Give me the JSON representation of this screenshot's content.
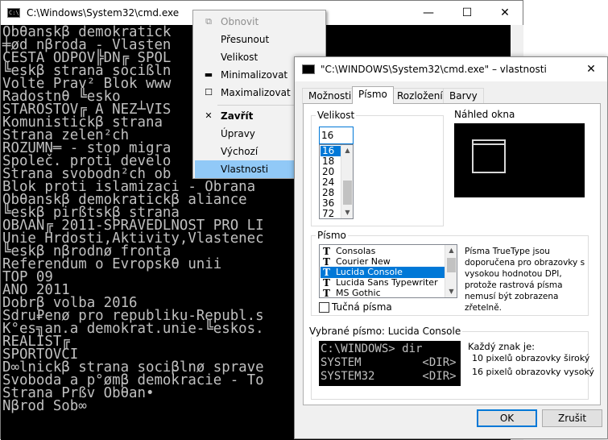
{
  "cmd": {
    "title": "C:\\Windows\\System32\\cmd.exe",
    "icon": "console-icon",
    "caption_buttons": {
      "minimize": "—",
      "maximize": "☐",
      "close": "✕"
    },
    "console_lines": [
      "Obθanskβ demokratick",
      "╪ød nβroda - Vlasten",
      "CESTA ODPOV╠DN╔ SPOL",
      "╚eskβ strana socißln",
      "Volte Prav² Blok www",
      "Radostnθ ╚esko",
      "STAROSTOV╔ A NEZ┴VIS",
      "Komunistickβ strana",
      "Strana zelen²ch",
      "ROZUMN═ - stop migra",
      "Společ. proti develo",
      "Strana svobodn²ch ob",
      "Blok proti islamizaci - Obrana",
      "Obθanskβ demokratickβ aliance",
      "╚eskβ pirßtskβ strana",
      "OBΛAN╔ 2011-SPRAVEDLNOST PRO LI",
      "Unie Hrdosti,Aktivity,Vlastenec",
      "╚eskβ nβrodnø fronta",
      "Referendum o Evropskθ unii",
      "TOP 09",
      "ANO 2011",
      "Dobrβ volba 2016",
      "Sdru₽enø pro republiku-Republ.s",
      "K°es╗an.a demokrat.unie-╚eskos.",
      "REALIST╔",
      "SPORTOVCI",
      "D∞lnickβ strana sociβlnø sprave",
      "Svoboda a p°ømβ demokracie - To",
      "Strana Prßv Obθan•",
      "Nβrod Sob∞"
    ]
  },
  "system_menu": {
    "items": [
      {
        "label": "Obnovit",
        "icon": "⧉",
        "disabled": true
      },
      {
        "label": "Přesunout",
        "icon": ""
      },
      {
        "label": "Velikost",
        "icon": ""
      },
      {
        "label": "Minimalizovat",
        "icon": "▬"
      },
      {
        "label": "Maximalizovat",
        "icon": "☐"
      },
      {
        "label": "Zavřít",
        "icon": "✕",
        "bold": true
      },
      {
        "label": "Úpravy",
        "icon": ""
      },
      {
        "label": "Výchozí",
        "icon": ""
      },
      {
        "label": "Vlastnosti",
        "icon": "",
        "selected": true
      }
    ]
  },
  "dialog": {
    "title": "\"C:\\WINDOWS\\System32\\cmd.exe\" – vlastnosti",
    "close": "✕",
    "tabs": [
      "Možnosti",
      "Písmo",
      "Rozložení",
      "Barvy"
    ],
    "active_tab": "Písmo",
    "size": {
      "label": "Velikost",
      "value": "16",
      "options": [
        "16",
        "18",
        "20",
        "24",
        "28",
        "36",
        "72"
      ],
      "selected": "16"
    },
    "preview": {
      "label": "Náhled okna"
    },
    "font": {
      "label": "Písmo",
      "options": [
        "Consolas",
        "Courier New",
        "Lucida Console",
        "Lucida Sans Typewriter",
        "MS Gothic"
      ],
      "selected": "Lucida Console",
      "bold_label": "Tučná písma",
      "bold_checked": false,
      "info": "Písma TrueType jsou doporučena pro obrazovky s vysokou hodnotou DPI, protože rastrová písma nemusí být zobrazena zřetelně."
    },
    "selected_font": {
      "label": "Vybrané písmo: Lucida Console",
      "sample_lines": [
        "C:\\WINDOWS> dir",
        "SYSTEM         <DIR>",
        "SYSTEM32       <DIR>"
      ],
      "char_heading": "Každý znak je:",
      "char_width": "10 pixelů obrazovky široký",
      "char_height": "16 pixelů obrazovky vysoký"
    },
    "buttons": {
      "ok": "OK",
      "cancel": "Zrušit"
    }
  }
}
